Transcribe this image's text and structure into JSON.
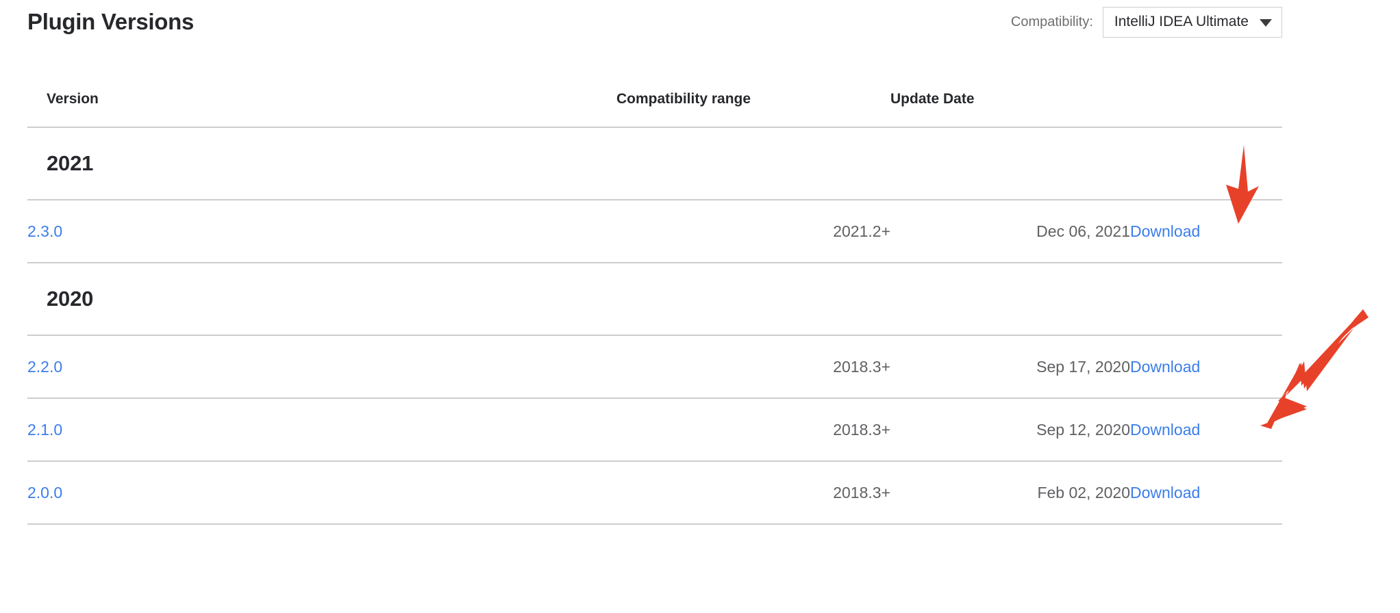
{
  "header": {
    "title": "Plugin Versions",
    "compatibility_label": "Compatibility:",
    "compatibility_value": "IntelliJ IDEA Ultimate",
    "caret_icon": "chevron-down-icon"
  },
  "table": {
    "columns": {
      "version": "Version",
      "range": "Compatibility range",
      "date": "Update Date",
      "action": ""
    },
    "groups": [
      {
        "year": "2021",
        "rows": [
          {
            "version": "2.3.0",
            "range": "2021.2+",
            "date": "Dec 06, 2021",
            "action": "Download"
          }
        ]
      },
      {
        "year": "2020",
        "rows": [
          {
            "version": "2.2.0",
            "range": "2018.3+",
            "date": "Sep 17, 2020",
            "action": "Download"
          },
          {
            "version": "2.1.0",
            "range": "2018.3+",
            "date": "Sep 12, 2020",
            "action": "Download"
          },
          {
            "version": "2.0.0",
            "range": "2018.3+",
            "date": "Feb 02, 2020",
            "action": "Download"
          }
        ]
      }
    ]
  },
  "annotations": [
    {
      "name": "arrow-pointing-to-2021-download",
      "icon": "arrow-down-icon",
      "color": "#e8412a"
    },
    {
      "name": "arrow-pointing-to-2020-download",
      "icon": "arrow-down-left-icon",
      "color": "#e8412a"
    }
  ],
  "colors": {
    "link": "#3b7deb",
    "text": "#27282c",
    "muted": "#5f6063",
    "rule": "#cdcdcd",
    "annotation_red": "#e8412a",
    "background": "#ffffff"
  }
}
